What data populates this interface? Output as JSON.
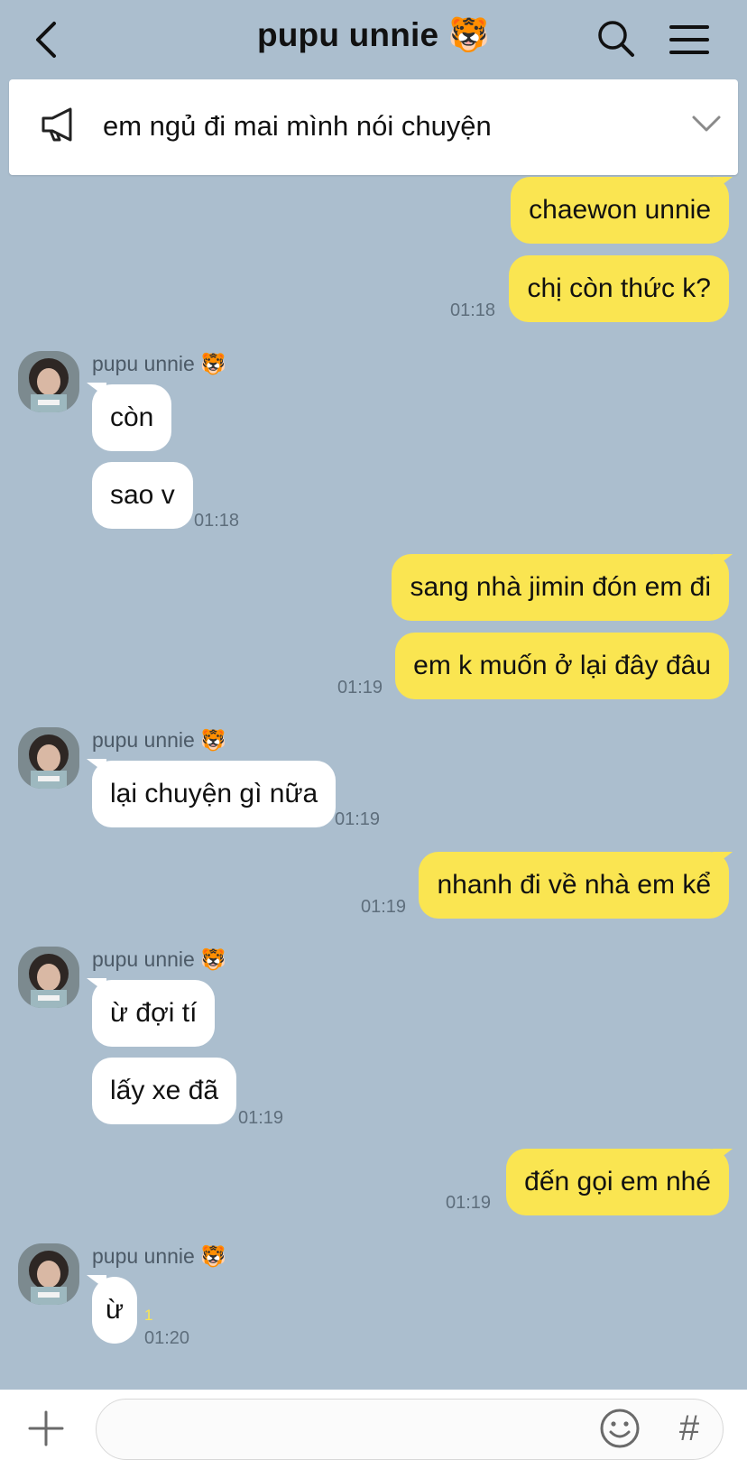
{
  "header": {
    "title": "pupu unnie 🐯",
    "back_icon": "chevron-left-icon",
    "search_icon": "search-icon",
    "menu_icon": "hamburger-menu-icon"
  },
  "notice": {
    "icon": "megaphone-icon",
    "text": "em ngủ đi mai mình nói chuyện",
    "chevron_icon": "chevron-down-icon"
  },
  "contact": {
    "name": "pupu unnie 🐯"
  },
  "messages": [
    {
      "from": "me",
      "text": "chaewon unnie",
      "time": ""
    },
    {
      "from": "me",
      "text": "chị còn thức k?",
      "time": "01:18"
    },
    {
      "from": "them",
      "text": "còn",
      "time": ""
    },
    {
      "from": "them",
      "text": "sao v",
      "time": "01:18"
    },
    {
      "from": "me",
      "text": "sang nhà jimin đón em đi",
      "time": ""
    },
    {
      "from": "me",
      "text": "em k muốn ở lại đây đâu",
      "time": "01:19"
    },
    {
      "from": "them",
      "text": "lại chuyện gì nữa",
      "time": "01:19"
    },
    {
      "from": "me",
      "text": "nhanh đi về nhà em kể",
      "time": "01:19"
    },
    {
      "from": "them",
      "text": "ừ đợi tí",
      "time": ""
    },
    {
      "from": "them",
      "text": "lấy xe đã",
      "time": "01:19"
    },
    {
      "from": "me",
      "text": "đến gọi em nhé",
      "time": "01:19"
    },
    {
      "from": "them",
      "text": "ừ",
      "time": "01:20",
      "unread": "1"
    }
  ],
  "input": {
    "placeholder": "",
    "plus_icon": "plus-icon",
    "emoji_icon": "emoji-smiley-icon",
    "hash_label": "#"
  },
  "colors": {
    "background": "#abbece",
    "my_bubble": "#fae551",
    "their_bubble": "#ffffff",
    "timestamp": "#5e6e7c"
  }
}
